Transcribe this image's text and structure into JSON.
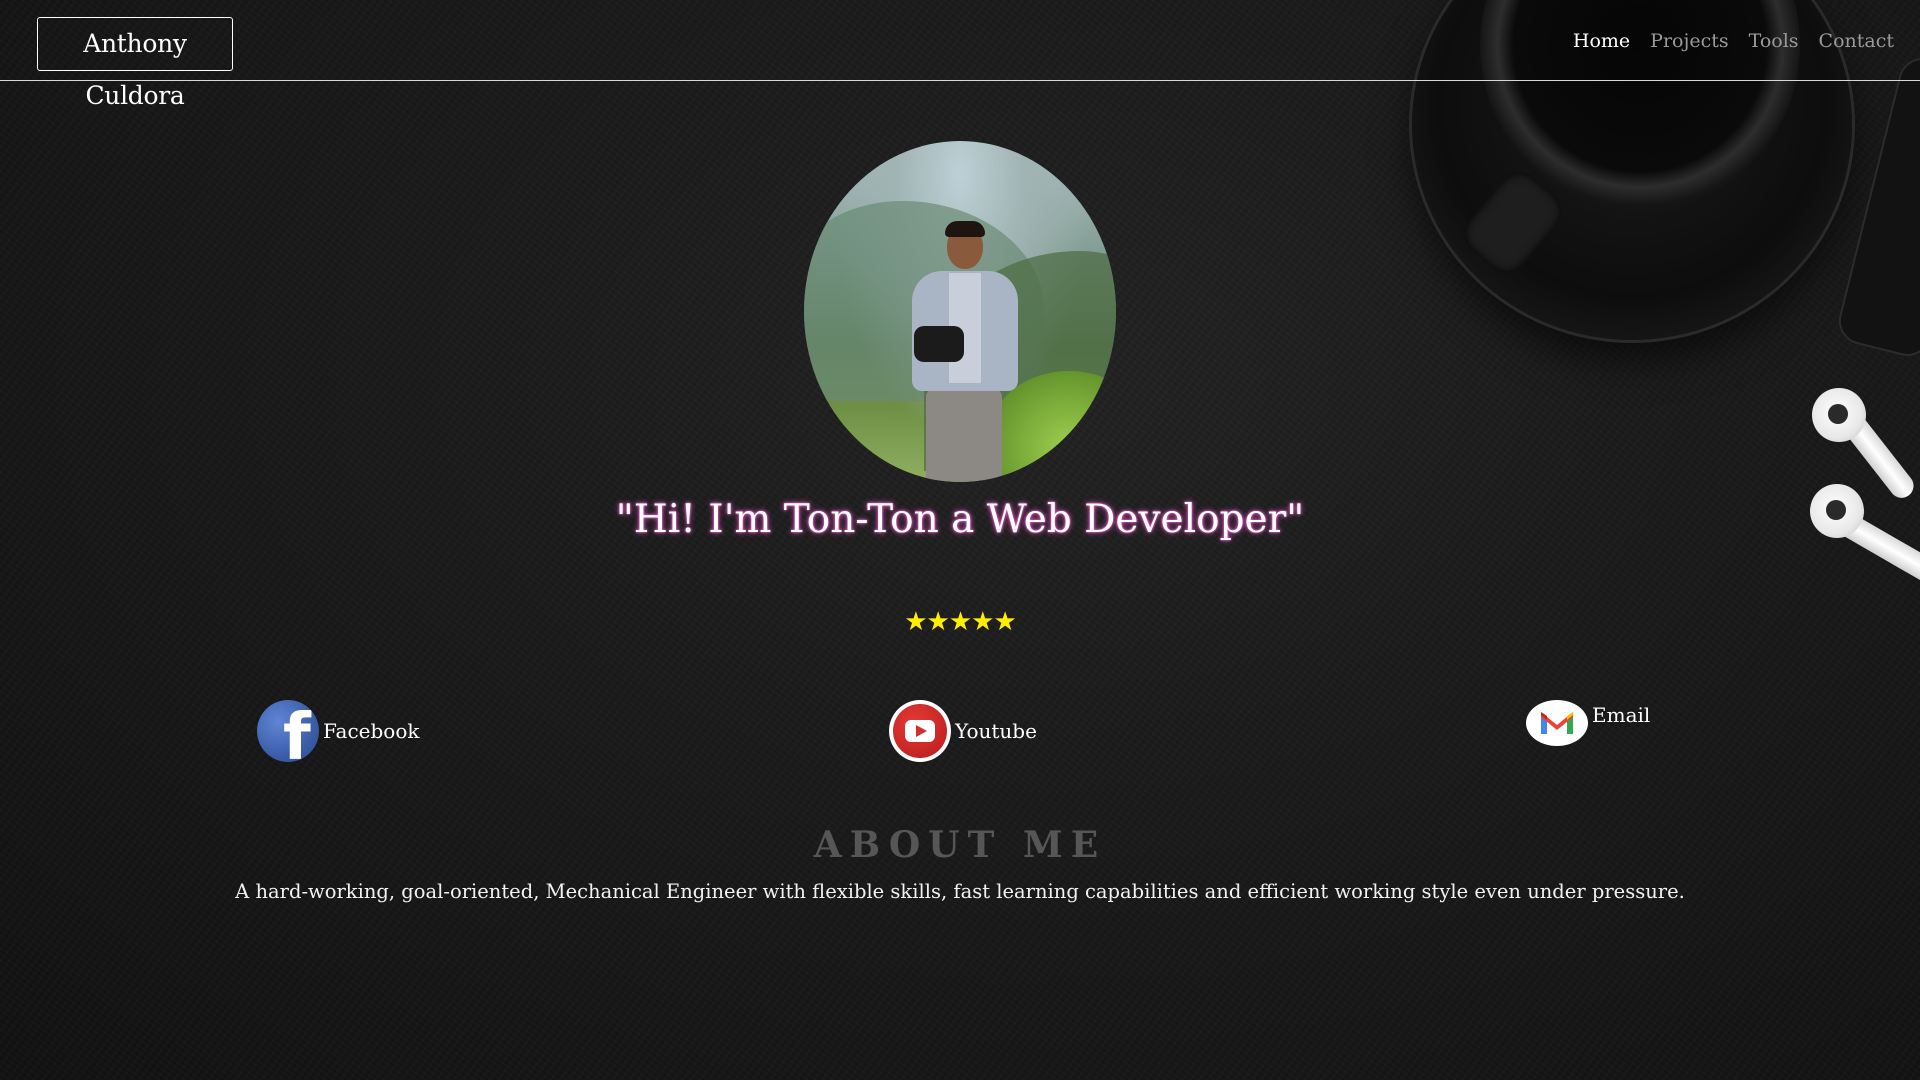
{
  "header": {
    "brand": "Anthony Culdora",
    "nav": [
      {
        "label": "Home",
        "active": true
      },
      {
        "label": "Projects",
        "active": false
      },
      {
        "label": "Tools",
        "active": false
      },
      {
        "label": "Contact",
        "active": false
      }
    ]
  },
  "hero": {
    "headline": "\"Hi! I'm Ton-Ton a Web Developer\"",
    "rating_stars": "★★★★★",
    "rating": 5
  },
  "social": [
    {
      "label": "Facebook",
      "icon": "facebook-icon"
    },
    {
      "label": "Youtube",
      "icon": "youtube-icon"
    },
    {
      "label": "Email",
      "icon": "gmail-icon"
    }
  ],
  "about": {
    "title": "ABOUT ME",
    "text": "A hard-working, goal-oriented, Mechanical Engineer with flexible skills, fast learning capabilities and efficient working style even under pressure."
  },
  "colors": {
    "background": "#141414",
    "star": "#ffee00",
    "headline_glow": "#ff4fd8",
    "nav_inactive": "#9a9a9a",
    "about_title": "#565656"
  }
}
